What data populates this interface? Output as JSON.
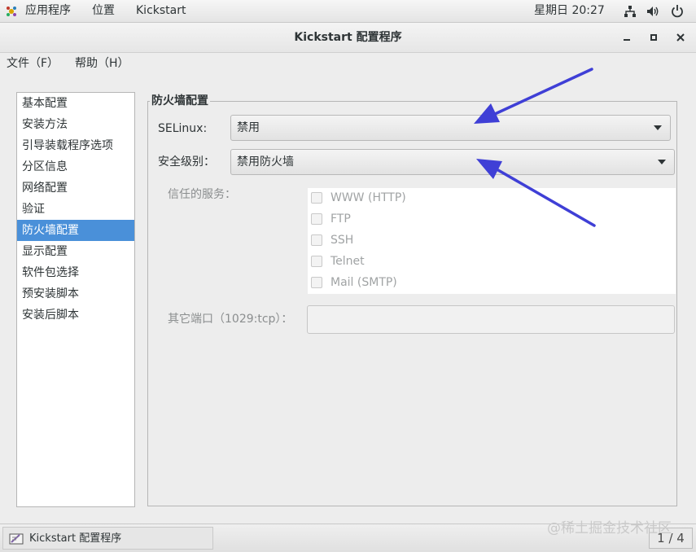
{
  "panel": {
    "apps": "应用程序",
    "places": "位置",
    "app_name": "Kickstart",
    "clock": "星期日 20:27",
    "icons": [
      "network-icon",
      "volume-icon",
      "power-icon"
    ]
  },
  "window": {
    "title": "Kickstart 配置程序"
  },
  "menu": {
    "file": "文件（F）",
    "help": "帮助（H）"
  },
  "sidebar": {
    "items": [
      {
        "label": "基本配置"
      },
      {
        "label": "安装方法"
      },
      {
        "label": "引导装载程序选项"
      },
      {
        "label": "分区信息"
      },
      {
        "label": "网络配置"
      },
      {
        "label": "验证"
      },
      {
        "label": "防火墙配置",
        "selected": true
      },
      {
        "label": "显示配置"
      },
      {
        "label": "软件包选择"
      },
      {
        "label": "预安装脚本"
      },
      {
        "label": "安装后脚本"
      }
    ]
  },
  "firewall": {
    "frame_title": "防火墙配置",
    "selinux_label": "SELinux:",
    "selinux_value": "禁用",
    "security_label": "安全级别：",
    "security_value": "禁用防火墙",
    "trusted_label": "信任的服务：",
    "services": [
      {
        "label": "WWW (HTTP)",
        "checked": false
      },
      {
        "label": "FTP",
        "checked": false
      },
      {
        "label": "SSH",
        "checked": false
      },
      {
        "label": "Telnet",
        "checked": false
      },
      {
        "label": "Mail (SMTP)",
        "checked": false
      }
    ],
    "other_ports_label": "其它端口（1029:tcp）：",
    "other_ports_value": ""
  },
  "taskbar": {
    "task_label": "Kickstart 配置程序",
    "pager": "1 / 4"
  },
  "watermark": "@稀土掘金技术社区",
  "colors": {
    "selection": "#4a90d9",
    "annotation_arrow": "#3f3fd6"
  }
}
